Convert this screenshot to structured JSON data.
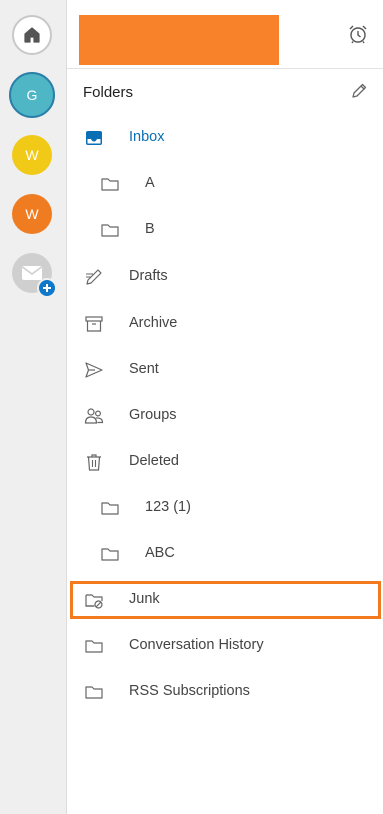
{
  "header": {
    "alarm_icon": "alarm-clock-icon"
  },
  "folders": {
    "title": "Folders",
    "items": [
      {
        "label": "Inbox",
        "icon": "inbox-icon",
        "level": 0,
        "selected": true
      },
      {
        "label": "A",
        "icon": "folder-icon",
        "level": 1
      },
      {
        "label": "B",
        "icon": "folder-icon",
        "level": 1
      },
      {
        "label": "Drafts",
        "icon": "pencil-icon",
        "level": 0
      },
      {
        "label": "Archive",
        "icon": "archive-icon",
        "level": 0
      },
      {
        "label": "Sent",
        "icon": "send-icon",
        "level": 0
      },
      {
        "label": "Groups",
        "icon": "groups-icon",
        "level": 0
      },
      {
        "label": "Deleted",
        "icon": "trash-icon",
        "level": 0
      },
      {
        "label": "123 (1)",
        "icon": "folder-icon",
        "level": 1
      },
      {
        "label": "ABC",
        "icon": "folder-icon",
        "level": 1
      },
      {
        "label": "Junk",
        "icon": "junk-folder-icon",
        "level": 0,
        "highlighted": true
      },
      {
        "label": "Conversation History",
        "icon": "folder-icon",
        "level": 0
      },
      {
        "label": "RSS Subscriptions",
        "icon": "folder-icon",
        "level": 0
      }
    ]
  },
  "accounts": [
    {
      "initial": "G",
      "color": "#4fb6c6",
      "active": true
    },
    {
      "initial": "W",
      "color": "#f1c917"
    },
    {
      "initial": "W",
      "color": "#f07c22"
    }
  ],
  "colors": {
    "accent": "#0a6fb5",
    "highlight": "#f47a20",
    "redaction": "#f78229"
  }
}
